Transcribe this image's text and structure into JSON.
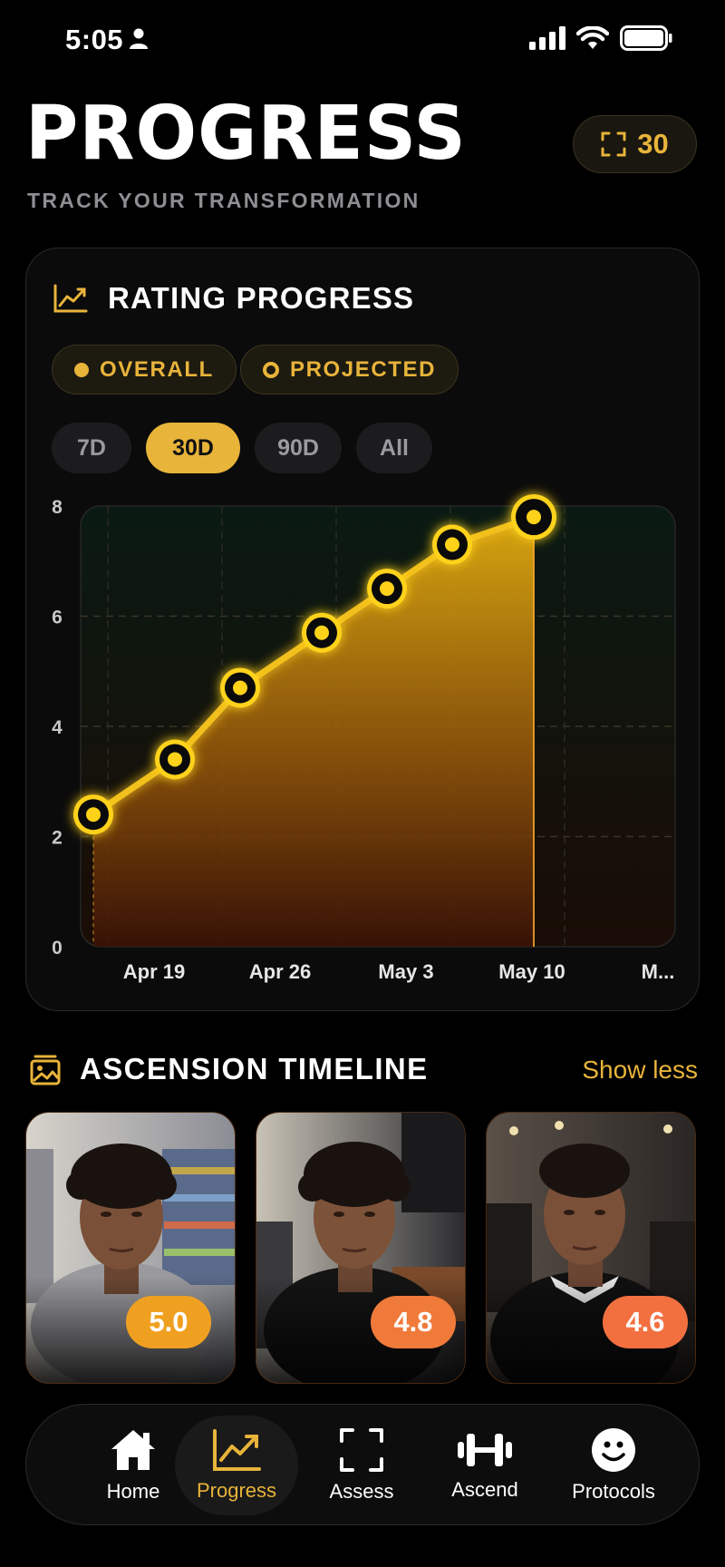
{
  "status_bar": {
    "time": "5:05"
  },
  "header": {
    "title": "PROGRESS",
    "subtitle": "TRACK YOUR TRANSFORMATION",
    "streak_count": "30"
  },
  "chart_card": {
    "title": "RATING PROGRESS",
    "legend": [
      {
        "label": "OVERALL",
        "style": "filled"
      },
      {
        "label": "PROJECTED",
        "style": "ring"
      }
    ],
    "ranges": [
      "7D",
      "30D",
      "90D",
      "All"
    ],
    "selected_range": "30D"
  },
  "chart_data": {
    "type": "area",
    "title": "RATING PROGRESS",
    "x_tick_labels": [
      "Apr 19",
      "Apr 26",
      "May 3",
      "May 10",
      "M..."
    ],
    "y_ticks": [
      0,
      2,
      4,
      6,
      8
    ],
    "ylim": [
      0,
      8
    ],
    "series": [
      {
        "name": "OVERALL",
        "x": [
          "Apr 16",
          "Apr 21",
          "Apr 25",
          "Apr 30",
          "May 4",
          "May 8",
          "May 13"
        ],
        "values": [
          2.4,
          3.4,
          4.7,
          5.7,
          6.5,
          7.3,
          7.8
        ]
      }
    ],
    "grid": true,
    "colors": {
      "line": "#f2c01f",
      "fill_top": "#d9a40e",
      "fill_bottom": "#3a1206"
    }
  },
  "timeline": {
    "title": "ASCENSION TIMELINE",
    "toggle_label": "Show less",
    "entries": [
      {
        "score": "5.0",
        "badge_color": "#f0a020"
      },
      {
        "score": "4.8",
        "badge_color": "#f07a3a"
      },
      {
        "score": "4.6",
        "badge_color": "#f27040"
      }
    ]
  },
  "nav": {
    "items": [
      {
        "label": "Home",
        "icon": "home-icon"
      },
      {
        "label": "Progress",
        "icon": "chart-icon"
      },
      {
        "label": "Assess",
        "icon": "scan-icon"
      },
      {
        "label": "Ascend",
        "icon": "dumbbell-icon"
      },
      {
        "label": "Protocols",
        "icon": "smiley-icon"
      }
    ],
    "active": "Progress"
  },
  "colors": {
    "accent": "#e8b43a",
    "background": "#000000"
  }
}
